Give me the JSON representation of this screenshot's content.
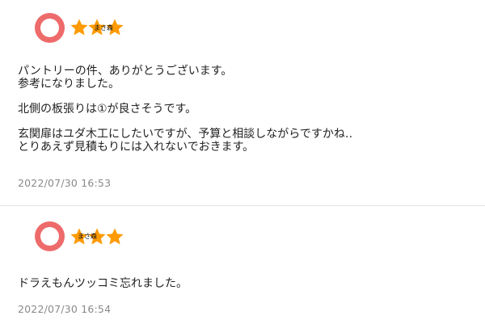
{
  "colors": {
    "avatar": "#ee6b6b",
    "star": "#ff9a00",
    "timestamp": "#8a8a8a",
    "text": "#222222",
    "divider": "#e2e2e2"
  },
  "comments": [
    {
      "avatar_icon": "user-avatar-icon",
      "nickname": "まさ森",
      "rating": 3,
      "body": {
        "line1": "パントリーの件、ありがとうございます。",
        "line2": "参考になりました。",
        "line3": "北側の板張りは①が良さそうです。",
        "line4": "玄関扉はユダ木工にしたいですが、予算と相談しながらですかね‥",
        "line5": "とりあえず見積もりには入れないでおきます。"
      },
      "timestamp": "2022/07/30 16:53"
    },
    {
      "avatar_icon": "user-avatar-icon",
      "nickname": "まさ森",
      "rating": 3,
      "body": {
        "line1": "ドラえもんツッコミ忘れました。"
      },
      "timestamp": "2022/07/30 16:54"
    }
  ]
}
